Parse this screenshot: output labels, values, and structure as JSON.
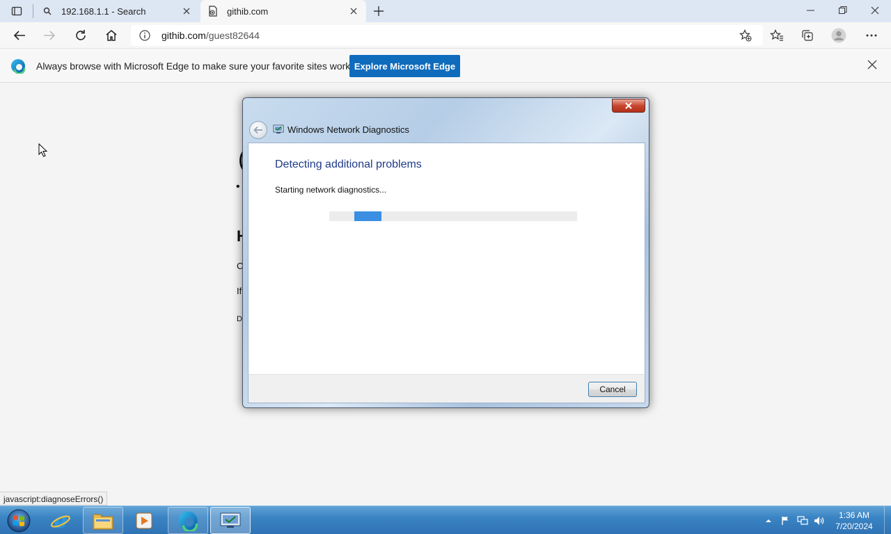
{
  "browser": {
    "tabs": [
      {
        "title": "192.168.1.1 - Search",
        "icon": "search-icon"
      },
      {
        "title": "githib.com",
        "icon": "page-error-icon"
      }
    ],
    "address": {
      "host": "githib.com",
      "path": "/guest82644"
    }
  },
  "infobar": {
    "message": "Always browse with Microsoft Edge to make sure your favorite sites work",
    "button_label": "Explore Microsoft Edge"
  },
  "page": {
    "fragments": [
      "(",
      "•",
      "H",
      "C",
      "If",
      "D"
    ]
  },
  "status_bar": {
    "text": "javascript:diagnoseErrors()"
  },
  "dialog": {
    "title": "Windows Network Diagnostics",
    "heading": "Detecting additional problems",
    "status": "Starting network diagnostics...",
    "cancel_label": "Cancel"
  },
  "taskbar": {
    "items": [
      "start-orb",
      "internet-explorer",
      "file-explorer",
      "media-player",
      "microsoft-edge",
      "network-diagnostics"
    ],
    "clock": {
      "time": "1:36 AM",
      "date": "7/20/2024"
    }
  },
  "colors": {
    "accent": "#0f6cbd",
    "heading": "#1e3a8a",
    "progress": "#3b8fe3"
  }
}
